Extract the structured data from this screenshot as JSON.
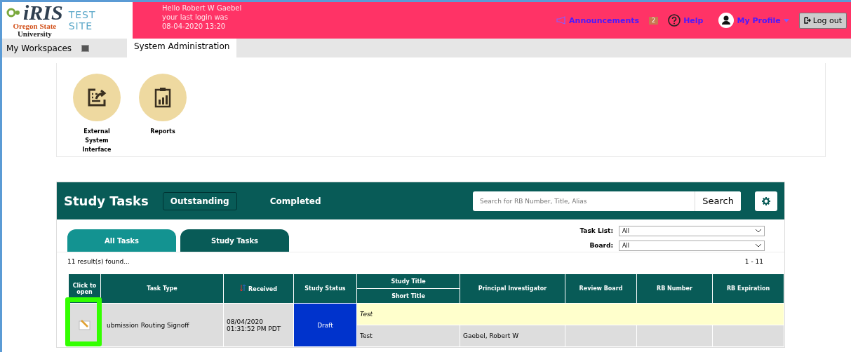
{
  "header": {
    "logo": "iRIS",
    "university_line_1": "Oregon State",
    "university_line_2": "University",
    "site_line_1": "TEST",
    "site_line_2": "SITE",
    "greeting": [
      "Hello Robert W Gaebel",
      "your last login was",
      "08-04-2020 13:20"
    ],
    "announcements": {
      "label": "Announcements",
      "count": "2"
    },
    "help": "Help",
    "profile": "My Profile",
    "logout": "Log out"
  },
  "nav": {
    "workspaces": "My Workspaces",
    "tabs": [
      {
        "label": "System Administration",
        "selected": true
      }
    ]
  },
  "tiles": [
    {
      "kind": "external",
      "label": "External System Interface"
    },
    {
      "kind": "reports",
      "label": "Reports"
    }
  ],
  "study_tasks": {
    "title": "Study Tasks",
    "filters": [
      {
        "label": "Outstanding",
        "selected": true
      },
      {
        "label": "Completed",
        "selected": false
      }
    ],
    "search": {
      "placeholder": "Search for RB Number, Title, Alias",
      "button": "Search"
    },
    "task_tabs": [
      {
        "label": "All Tasks",
        "selected": false
      },
      {
        "label": "Study Tasks",
        "selected": true
      }
    ],
    "selects": [
      {
        "label": "Task List:",
        "value": "All"
      },
      {
        "label": "Board:",
        "value": "All"
      }
    ],
    "results": "11 result(s) found...",
    "range": "1 - 11",
    "columns": [
      "Click to open",
      "Task Type",
      "Received",
      "Study Status",
      "Study Title",
      "Short Title",
      "Principal Investigator",
      "Review Board",
      "RB Number",
      "RB Expiration"
    ],
    "rows": [
      {
        "task_type": "ubmission Routing Signoff",
        "received": [
          "08/04/2020",
          "01:31:52 PM PDT"
        ],
        "status": "Draft",
        "study_title": "Test",
        "short_title": "Test",
        "pi": "Gaebel, Robert W",
        "highlighted": true
      }
    ]
  }
}
